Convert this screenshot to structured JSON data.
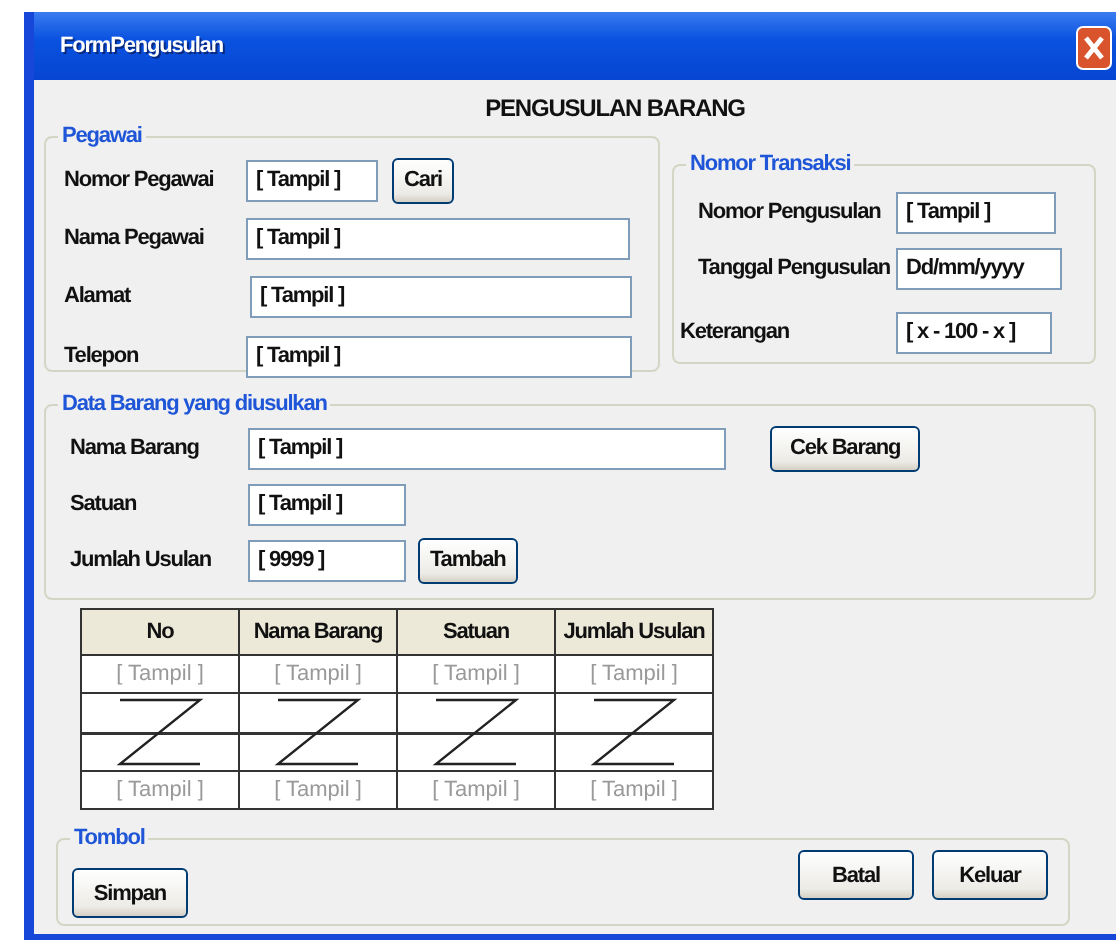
{
  "window": {
    "title": "FormPengusulan"
  },
  "heading": "PENGUSULAN BARANG",
  "pegawai": {
    "title": "Pegawai",
    "fields": [
      {
        "label": "Nomor Pegawai",
        "value": "[ Tampil ]",
        "button": "Cari"
      },
      {
        "label": "Nama Pegawai",
        "value": "[ Tampil ]"
      },
      {
        "label": "Alamat",
        "value": "[ Tampil ]"
      },
      {
        "label": "Telepon",
        "value": "[ Tampil ]"
      }
    ]
  },
  "transaksi": {
    "title": "Nomor Transaksi",
    "fields": [
      {
        "label": "Nomor Pengusulan",
        "value": "[ Tampil ]"
      },
      {
        "label": "Tanggal Pengusulan",
        "value": "Dd/mm/yyyy"
      },
      {
        "label": "Keterangan",
        "value": "[ x - 100 - x ]"
      }
    ]
  },
  "barang": {
    "title": "Data Barang yang diusulkan",
    "fields": [
      {
        "label": "Nama Barang",
        "value": "[ Tampil ]",
        "button": "Cek Barang"
      },
      {
        "label": "Satuan",
        "value": "[ Tampil ]"
      },
      {
        "label": "Jumlah Usulan",
        "value": "[ 9999 ]",
        "button": "Tambah"
      }
    ]
  },
  "table": {
    "columns": [
      "No",
      "Nama Barang",
      "Satuan",
      "Jumlah Usulan"
    ],
    "rows": [
      {
        "kind": "data",
        "cells": [
          "[ Tampil ]",
          "[ Tampil ]",
          "[ Tampil ]",
          "[ Tampil ]"
        ]
      },
      {
        "kind": "gap"
      },
      {
        "kind": "data",
        "cells": [
          "[ Tampil ]",
          "[ Tampil ]",
          "[ Tampil ]",
          "[ Tampil ]"
        ]
      }
    ]
  },
  "tombol": {
    "title": "Tombol",
    "left_buttons": [
      "Simpan"
    ],
    "right_buttons": [
      "Batal",
      "Keluar"
    ]
  }
}
